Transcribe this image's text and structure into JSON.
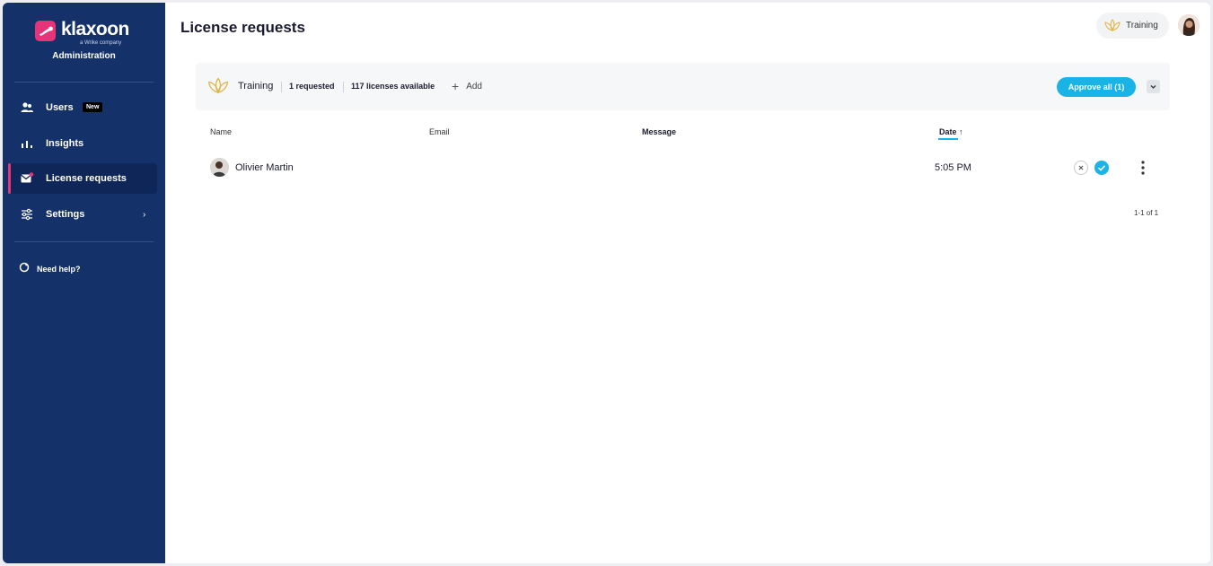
{
  "brand": {
    "name": "klaxoon",
    "subtitle": "a Wrike company",
    "section": "Administration"
  },
  "sidebar": {
    "items": [
      {
        "label": "Users",
        "badge": "New",
        "icon": "users-icon"
      },
      {
        "label": "Insights",
        "icon": "bar-chart-icon"
      },
      {
        "label": "License requests",
        "icon": "mail-icon",
        "active": true
      },
      {
        "label": "Settings",
        "icon": "sliders-icon",
        "has_submenu": true
      }
    ],
    "help": {
      "label": "Need help?",
      "icon": "help-icon"
    }
  },
  "header": {
    "title": "License requests",
    "workspace": {
      "label": "Training",
      "icon": "lotus-icon"
    }
  },
  "panel": {
    "workspace_label": "Training",
    "requested": "1 requested",
    "available": "117 licenses available",
    "add_label": "Add",
    "approve_all_label": "Approve all (1)"
  },
  "table": {
    "columns": {
      "name": "Name",
      "email": "Email",
      "message": "Message",
      "date": "Date"
    },
    "sort": {
      "column": "date",
      "direction": "ascending"
    },
    "rows": [
      {
        "name": "Olivier Martin",
        "email": "",
        "message": "",
        "date": "5:05 PM"
      }
    ],
    "pagination": "1-1 of 1"
  },
  "colors": {
    "sidebar": "#14316a",
    "accent": "#19b3e6",
    "brand": "#e6337a"
  }
}
